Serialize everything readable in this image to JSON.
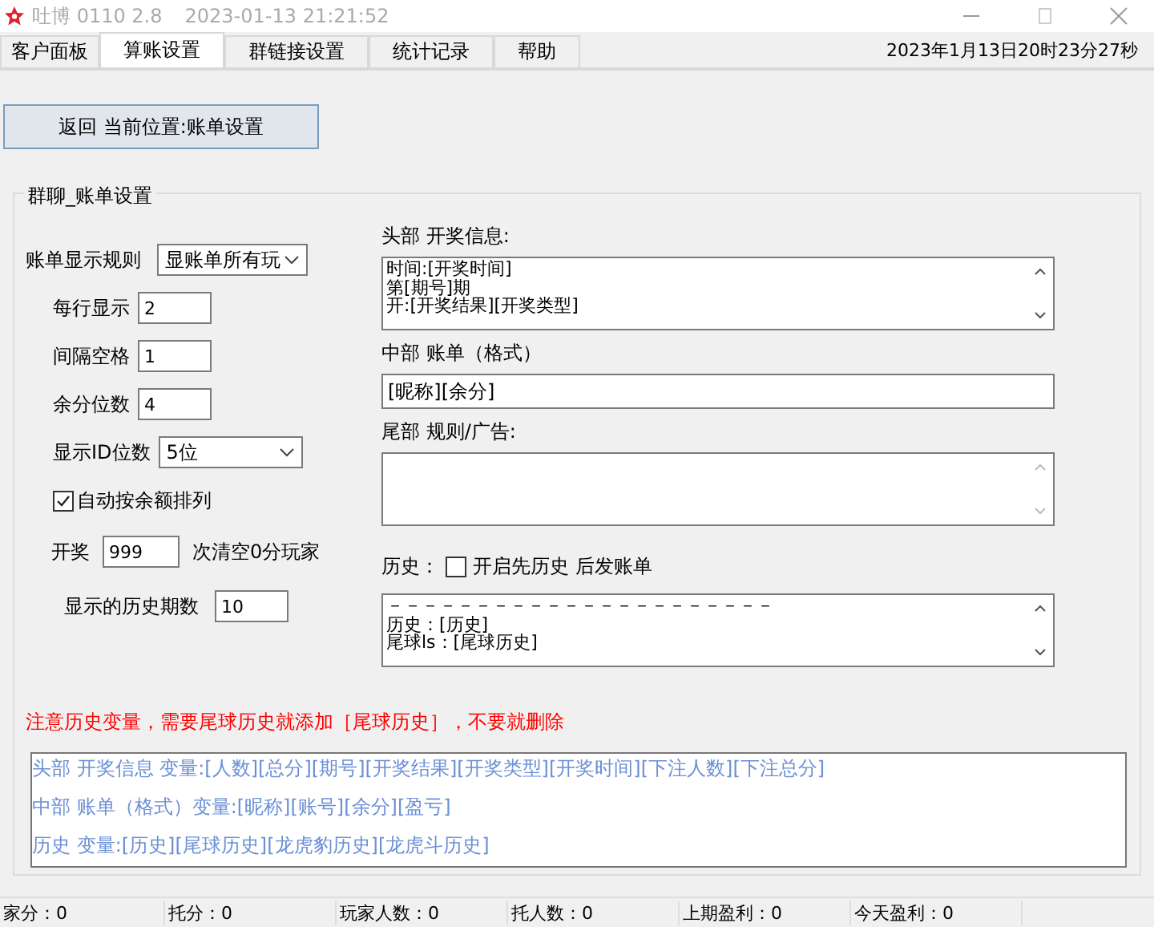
{
  "window": {
    "title": "吐博 0110 2.8",
    "timestamp": "2023-01-13 21:21:52"
  },
  "tabs": [
    {
      "label": "客户面板",
      "selected": false
    },
    {
      "label": "算账设置",
      "selected": true
    },
    {
      "label": "群链接设置",
      "selected": false
    },
    {
      "label": "统计记录",
      "selected": false
    },
    {
      "label": "帮助",
      "selected": false
    }
  ],
  "clock": "2023年1月13日20时23分27秒",
  "back_button": "返回   当前位置:账单设置",
  "group": {
    "title": "群聊_账单设置"
  },
  "bill_rule": {
    "label": "账单显示规则",
    "value": "显账单所有玩"
  },
  "fields": [
    {
      "label": "每行显示",
      "value": "2"
    },
    {
      "label": "间隔空格",
      "value": "1"
    },
    {
      "label": "余分位数",
      "value": "4"
    }
  ],
  "id_digits": {
    "label": "显示ID位数",
    "value": "5位"
  },
  "auto_sort": {
    "label": "自动按余额排列",
    "checked": true
  },
  "draw_clear": {
    "label": "开奖",
    "value": "999",
    "suffix": "次清空0分玩家"
  },
  "history_periods": {
    "label": "显示的历史期数",
    "value": "10"
  },
  "header": {
    "label": "头部 开奖信息:",
    "lines": [
      "时间:[开奖时间]",
      "第[期号]期",
      "开:[开奖结果][开奖类型]"
    ]
  },
  "middle": {
    "label": "中部 账单（格式）",
    "value": "[昵称][余分]"
  },
  "footer": {
    "label": "尾部 规则/广告:"
  },
  "history": {
    "label": "历史：",
    "toggle": {
      "label": "开启先历史 后发账单",
      "checked": false
    },
    "lines": [
      "－－－－－－－－－－－－－－－－－－－－－－",
      "历史：[历史]",
      "尾球ls：[尾球历史]"
    ]
  },
  "warning": "注意历史变量，需要尾球历史就添加［尾球历史］，不要就删除",
  "variables": [
    "头部 开奖信息 变量:[人数][总分][期号][开奖结果][开奖类型][开奖时间][下注人数][下注总分]",
    "中部 账单（格式）变量:[昵称][账号][余分][盈亏]",
    "历史 变量:[历史][尾球历史][龙虎豹历史][龙虎斗历史]"
  ],
  "status_bar": [
    "家分：0",
    "托分：0",
    "玩家人数：0",
    "托人数：0",
    "上期盈利：0",
    "今天盈利：0"
  ]
}
